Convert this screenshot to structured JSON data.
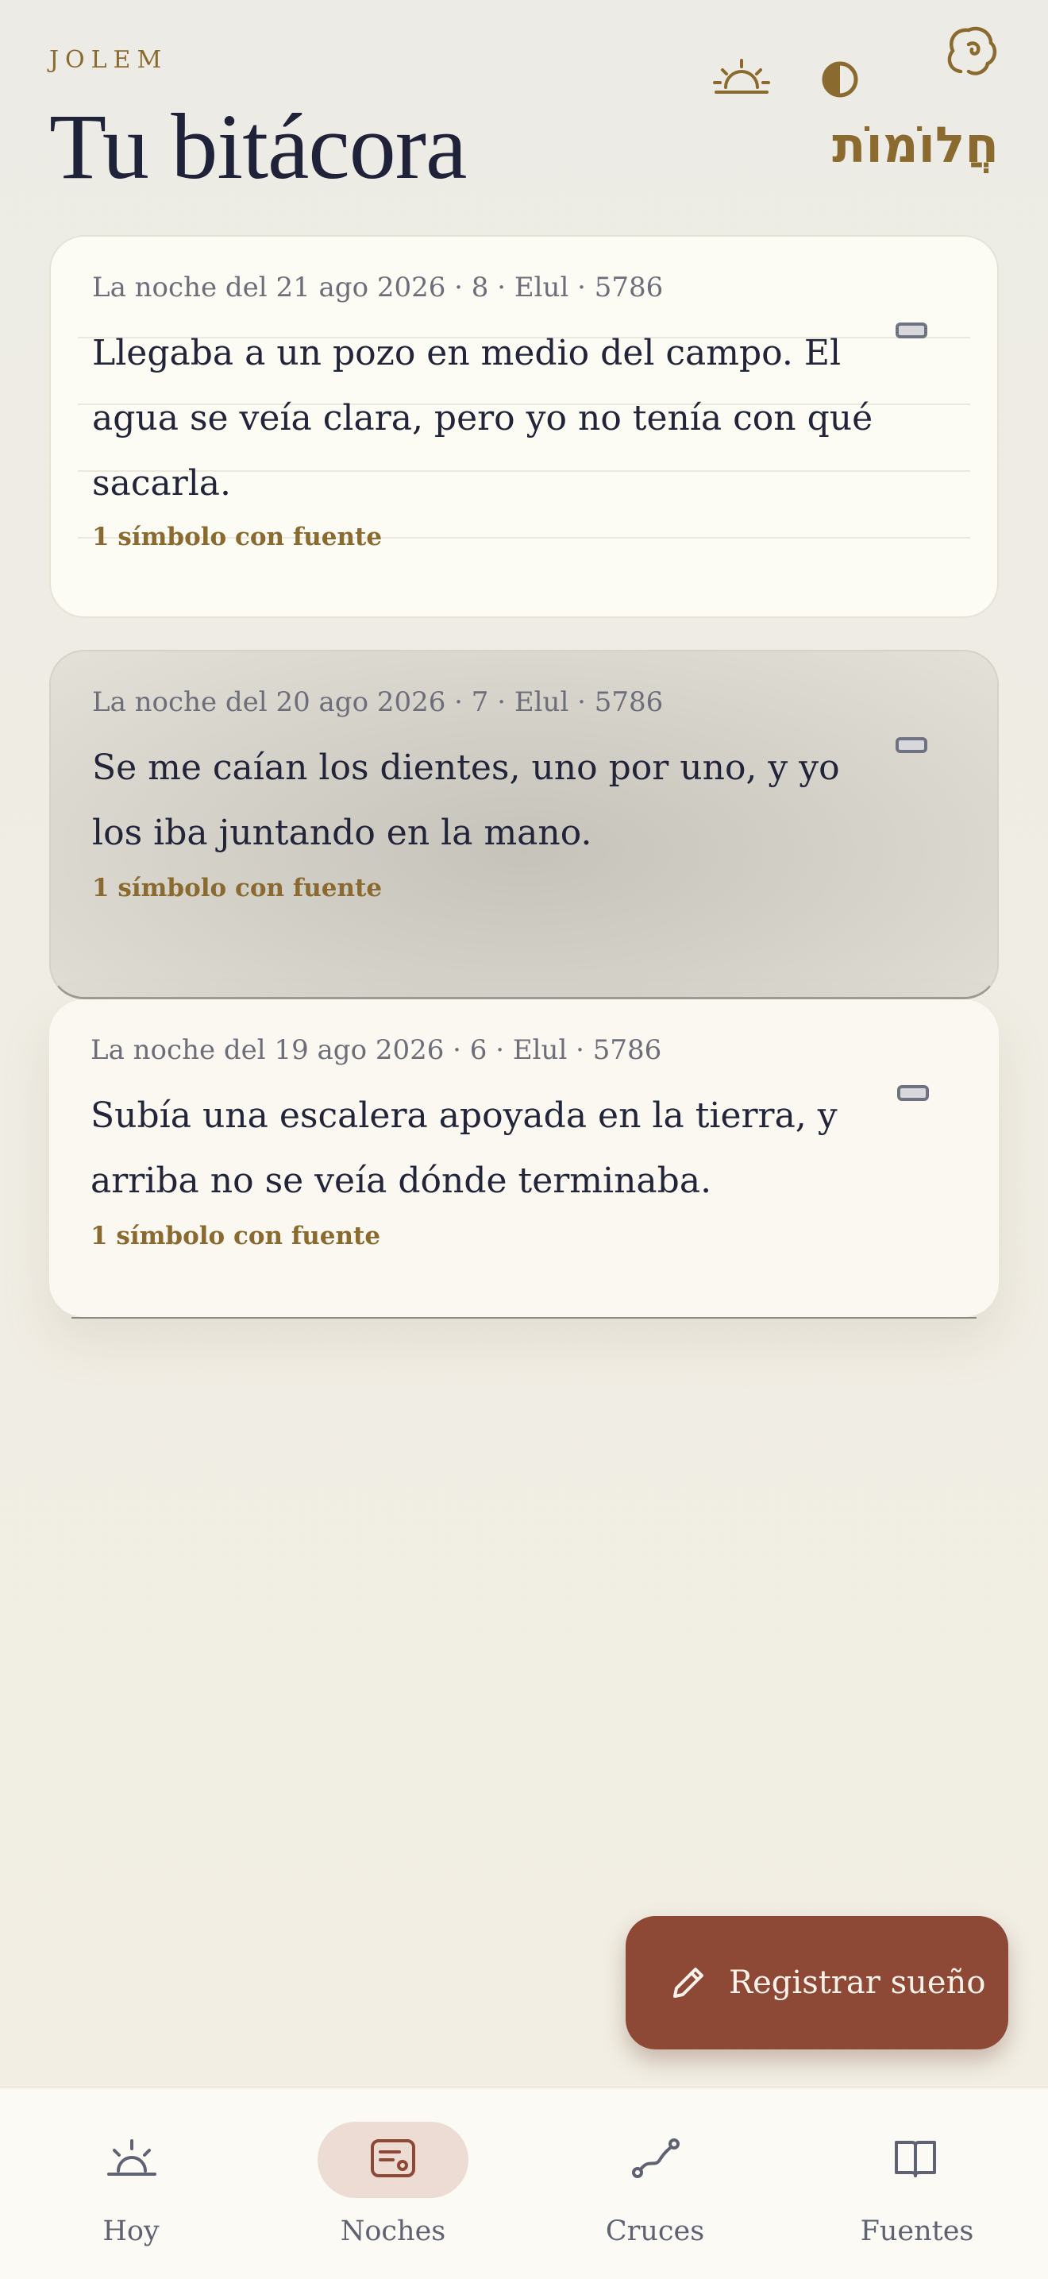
{
  "header": {
    "app_label": "JOLEM",
    "title": "Tu bitácora",
    "hebrew": "חֲלוֹמוֹת",
    "icons": [
      "sunrise-icon",
      "half-moon-icon",
      "dream-cloud-icon"
    ]
  },
  "cards": [
    {
      "date": "La noche del 21 ago 2026 · 8 · Elul · 5786",
      "text": "Llegaba a un pozo en medio del campo. El agua se veía clara, pero yo no tenía con qué sacarla.",
      "meta": "1 símbolo con fuente"
    },
    {
      "date": "La noche del 20 ago 2026 · 7 · Elul · 5786",
      "text": "Se me caían los dientes, uno por uno, y yo los iba juntando en la mano.",
      "meta": "1 símbolo con fuente"
    },
    {
      "date": "La noche del 19 ago 2026 · 6 · Elul · 5786",
      "text": "Subía una escalera apoyada en la tierra, y arriba no se veía dónde terminaba.",
      "meta": "1 símbolo con fuente"
    }
  ],
  "fab": {
    "label": "Registrar sueño"
  },
  "nav": [
    {
      "label": "Hoy",
      "icon": "sunrise-icon",
      "active": false
    },
    {
      "label": "Noches",
      "icon": "journal-card-icon",
      "active": true
    },
    {
      "label": "Cruces",
      "icon": "crossing-path-icon",
      "active": false
    },
    {
      "label": "Fuentes",
      "icon": "open-book-icon",
      "active": false
    }
  ],
  "colors": {
    "accent": "#8a6a2e",
    "fab": "#8d4836",
    "title": "#1f2238",
    "nav_active_pill": "#ecdcd3"
  }
}
